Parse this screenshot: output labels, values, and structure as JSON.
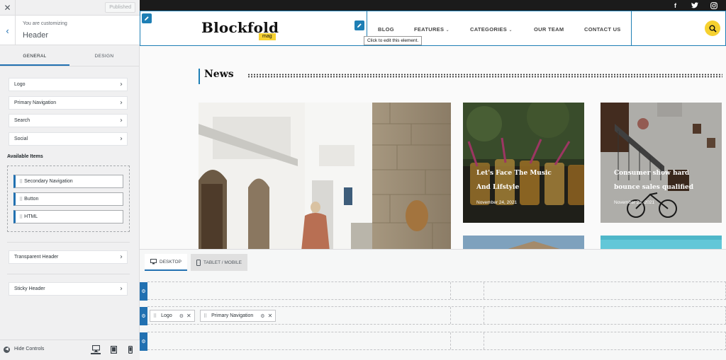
{
  "sidebar": {
    "close_icon": "close-icon",
    "published_label": "Published",
    "customizing_label": "You are customizing",
    "section_title": "Header",
    "tabs": [
      {
        "label": "GENERAL"
      },
      {
        "label": "DESIGN"
      }
    ],
    "items": [
      {
        "label": "Logo"
      },
      {
        "label": "Primary Navigation"
      },
      {
        "label": "Search"
      },
      {
        "label": "Social"
      }
    ],
    "available_label": "Available Items",
    "available_items": [
      {
        "label": "Secondary Navigation"
      },
      {
        "label": "Button"
      },
      {
        "label": "HTML"
      }
    ],
    "transparent_header": "Transparent Header",
    "sticky_header": "Sticky Header",
    "hide_controls": "Hide Controls"
  },
  "preview": {
    "logo": "Blockfold",
    "logo_sub": "mag",
    "nav": [
      {
        "label": "BLOG"
      },
      {
        "label": "FEATURES"
      },
      {
        "label": "CATEGORIES"
      },
      {
        "label": "OUR TEAM"
      },
      {
        "label": "CONTACT US"
      }
    ],
    "tooltip": "Click to edit this element.",
    "section_title": "News",
    "cards": [
      {
        "title_l1": "Let's Face The Music",
        "title_l2": "And Lifstyle",
        "date": "November 24, 2021"
      },
      {
        "title_l1": "Consumer show hard",
        "title_l2": "bounce sales qualified",
        "date": "November 23, 2021"
      }
    ],
    "accent_color": "#f6d130",
    "edit_color": "#1e7fb5"
  },
  "builder": {
    "tabs": [
      {
        "label": "DESKTOP"
      },
      {
        "label": "TABLET / MOBILE"
      }
    ],
    "row2_chips": [
      {
        "label": "Logo"
      },
      {
        "label": "Primary Navigation"
      }
    ]
  }
}
